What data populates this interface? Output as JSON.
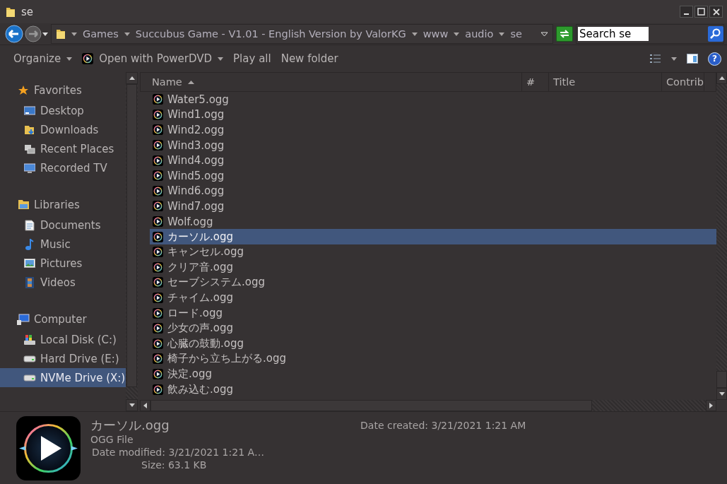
{
  "window": {
    "title": "se"
  },
  "address_bar": {
    "crumbs": [
      "Games",
      "Succubus Game - V1.01 - English Version by ValorKG",
      "www",
      "audio",
      "se"
    ]
  },
  "search": {
    "placeholder": "Search se"
  },
  "toolbar": {
    "buttons": [
      {
        "label": "Organize",
        "kind": "menu"
      },
      {
        "label": "Open with PowerDVD",
        "kind": "app_menu"
      },
      {
        "label": "Play all",
        "kind": "plain"
      },
      {
        "label": "New folder",
        "kind": "plain"
      }
    ],
    "help_glyph": "?"
  },
  "sidebar": {
    "groups": [
      {
        "label": "Favorites",
        "kind": "favorites",
        "children": [
          {
            "label": "Desktop",
            "kind": "desktop",
            "selected": false
          },
          {
            "label": "Downloads",
            "kind": "downloads",
            "selected": false
          },
          {
            "label": "Recent Places",
            "kind": "recent",
            "selected": false
          },
          {
            "label": "Recorded TV",
            "kind": "tv",
            "selected": false
          }
        ]
      },
      {
        "label": "Libraries",
        "kind": "libraries",
        "children": [
          {
            "label": "Documents",
            "kind": "documents",
            "selected": false
          },
          {
            "label": "Music",
            "kind": "music",
            "selected": false
          },
          {
            "label": "Pictures",
            "kind": "pictures",
            "selected": false
          },
          {
            "label": "Videos",
            "kind": "videos",
            "selected": false
          }
        ]
      },
      {
        "label": "Computer",
        "kind": "computer",
        "children": [
          {
            "label": "Local Disk (C:)",
            "kind": "system_disk",
            "selected": false
          },
          {
            "label": "Hard Drive (E:)",
            "kind": "drive",
            "selected": false
          },
          {
            "label": "NVMe Drive (X:)",
            "kind": "drive",
            "selected": true
          }
        ]
      }
    ]
  },
  "file_list": {
    "columns": [
      {
        "label": "Name",
        "sorted": true
      },
      {
        "label": "#",
        "sorted": false
      },
      {
        "label": "Title",
        "sorted": false
      },
      {
        "label": "Contrib",
        "sorted": false
      }
    ],
    "rows": [
      {
        "name": "Water5.ogg",
        "selected": false
      },
      {
        "name": "Wind1.ogg",
        "selected": false
      },
      {
        "name": "Wind2.ogg",
        "selected": false
      },
      {
        "name": "Wind3.ogg",
        "selected": false
      },
      {
        "name": "Wind4.ogg",
        "selected": false
      },
      {
        "name": "Wind5.ogg",
        "selected": false
      },
      {
        "name": "Wind6.ogg",
        "selected": false
      },
      {
        "name": "Wind7.ogg",
        "selected": false
      },
      {
        "name": "Wolf.ogg",
        "selected": false
      },
      {
        "name": "カーソル.ogg",
        "selected": true
      },
      {
        "name": "キャンセル.ogg",
        "selected": false
      },
      {
        "name": "クリア音.ogg",
        "selected": false
      },
      {
        "name": "セーブシステム.ogg",
        "selected": false
      },
      {
        "name": "チャイム.ogg",
        "selected": false
      },
      {
        "name": "ロード.ogg",
        "selected": false
      },
      {
        "name": "少女の声.ogg",
        "selected": false
      },
      {
        "name": "心臓の鼓動.ogg",
        "selected": false
      },
      {
        "name": "椅子から立ち上がる.ogg",
        "selected": false
      },
      {
        "name": "決定.ogg",
        "selected": false
      },
      {
        "name": "飲み込む.ogg",
        "selected": false
      }
    ]
  },
  "details": {
    "name": "カーソル.ogg",
    "type": "OGG File",
    "date_created": "Date created: 3/21/2021 1:21 AM",
    "date_modified": "Date modified: 3/21/2021 1:21 A…",
    "size": "Size: 63.1 KB"
  }
}
